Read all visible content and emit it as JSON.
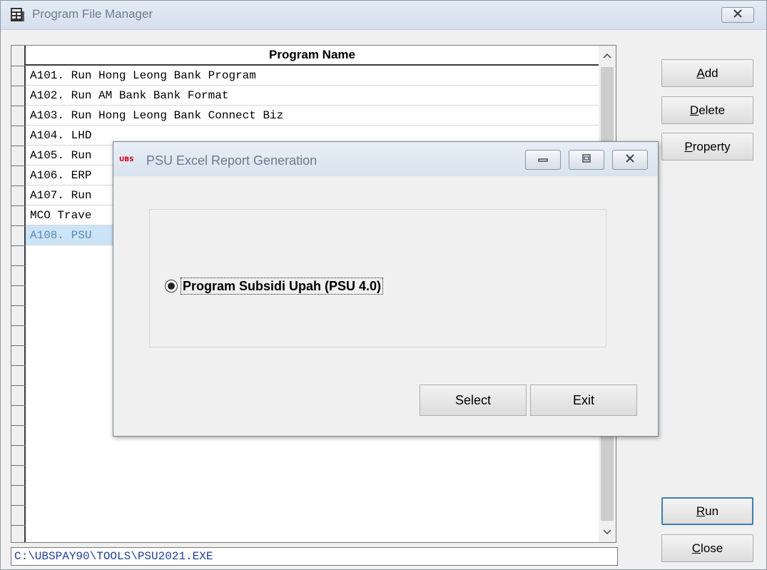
{
  "main_window": {
    "title": "Program File Manager",
    "icon": "program-manager-icon",
    "close_icon": "close-icon"
  },
  "grid": {
    "column_header": "Program Name",
    "rows": [
      {
        "label": "A101. Run Hong Leong Bank Program"
      },
      {
        "label": "A102. Run AM Bank Bank Format"
      },
      {
        "label": "A103. Run Hong Leong Bank Connect Biz"
      },
      {
        "label": "A104. LHD"
      },
      {
        "label": "A105. Run"
      },
      {
        "label": "A106. ERP"
      },
      {
        "label": "A107. Run"
      },
      {
        "label": "MCO Trave"
      },
      {
        "label": "A108. PSU"
      }
    ],
    "selected_row_label": "A108. PSU"
  },
  "path_field": {
    "value": "C:\\UBSPAY90\\TOOLS\\PSU2021.EXE"
  },
  "side_buttons": {
    "add": {
      "pre": "",
      "key": "A",
      "post": "dd"
    },
    "delete": {
      "pre": "",
      "key": "D",
      "post": "elete"
    },
    "property": {
      "pre": "",
      "key": "P",
      "post": "roperty"
    },
    "run": {
      "pre": "",
      "key": "R",
      "post": "un"
    },
    "close": {
      "pre": "",
      "key": "C",
      "post": "lose"
    }
  },
  "dialog": {
    "logo_text": "UBS",
    "title": "PSU Excel Report Generation",
    "radio_option": {
      "label": "Program Subsidi Upah (PSU 4.0)",
      "selected": true
    },
    "select_label": "Select",
    "exit_label": "Exit"
  },
  "colors": {
    "selection": "#cce4f7",
    "focus_border": "#3c7fb1",
    "path_text": "#1f3f9f",
    "logo_red": "#d4001a"
  }
}
